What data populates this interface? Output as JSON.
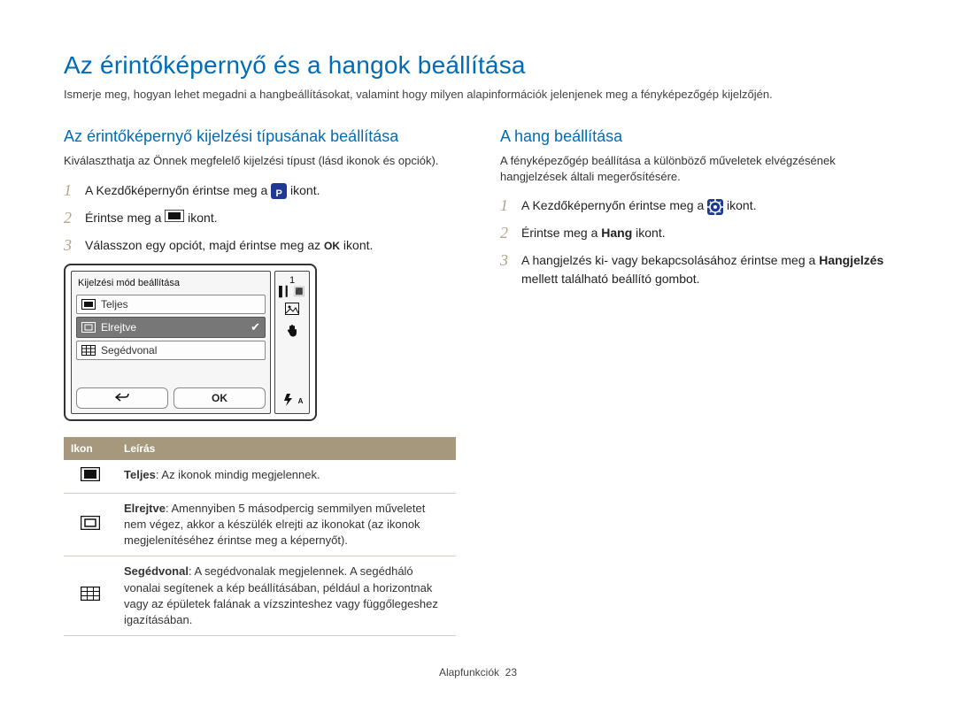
{
  "title": "Az érintőképernyő és a hangok beállítása",
  "intro": "Ismerje meg, hogyan lehet megadni a hangbeállításokat, valamint hogy milyen alapinformációk jelenjenek meg a fényképezőgép kijelzőjén.",
  "left": {
    "heading": "Az érintőképernyő kijelzési típusának beállítása",
    "sub": "Kiválaszthatja az Önnek megfelelő kijelzési típust (lásd ikonok és opciók).",
    "step1_a": "A Kezdőképernyőn érintse meg a ",
    "step1_b": " ikont.",
    "step2_a": "Érintse meg a ",
    "step2_b": " ikont.",
    "step3_a": "Válasszon egy opciót, majd érintse meg az ",
    "step3_ok": "OK",
    "step3_b": " ikont."
  },
  "device": {
    "title": "Kijelzési mód beállítása",
    "row1": "Teljes",
    "row2": "Elrejtve",
    "row3": "Segédvonal",
    "btn_ok": "OK",
    "status_badge": "1"
  },
  "table": {
    "h1": "Ikon",
    "h2": "Leírás",
    "r1_term": "Teljes",
    "r1_rest": ": Az ikonok mindig megjelennek.",
    "r2_term": "Elrejtve",
    "r2_rest": ": Amennyiben 5 másodpercig semmilyen műveletet nem végez, akkor a készülék elrejti az ikonokat (az ikonok megjelenítéséhez érintse meg a képernyőt).",
    "r3_term": "Segédvonal",
    "r3_rest": ": A segédvonalak megjelennek. A segédháló vonalai segítenek a kép beállításában, például a horizontnak vagy az épületek falának a vízszinteshez vagy függőlegeshez igazításában."
  },
  "right": {
    "heading": "A hang beállítása",
    "sub": "A fényképezőgép beállítása a különböző műveletek elvégzésének hangjelzések általi megerősítésére.",
    "step1_a": "A Kezdőképernyőn érintse meg a ",
    "step1_b": " ikont.",
    "step2_a": "Érintse meg a ",
    "step2_term": "Hang",
    "step2_b": " ikont.",
    "step3_a": "A hangjelzés ki- vagy bekapcsolásához érintse meg a ",
    "step3_term": "Hangjelzés",
    "step3_b": " mellett található beállító gombot."
  },
  "footer": {
    "section": "Alapfunkciók",
    "page": "23"
  }
}
